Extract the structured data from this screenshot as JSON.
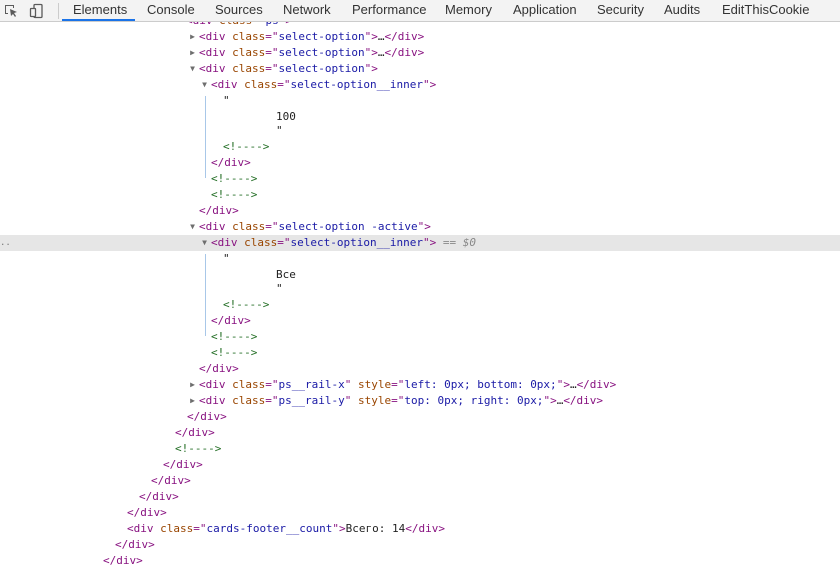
{
  "toolbar": {
    "tabs": [
      {
        "label": "Elements",
        "active": true
      },
      {
        "label": "Console"
      },
      {
        "label": "Sources"
      },
      {
        "label": "Network"
      },
      {
        "label": "Performance"
      },
      {
        "label": "Memory"
      },
      {
        "label": "Application"
      },
      {
        "label": "Security"
      },
      {
        "label": "Audits"
      },
      {
        "label": "EditThisCookie"
      }
    ],
    "icons": [
      "inspect-element-icon",
      "device-toolbar-icon"
    ]
  },
  "colors": {
    "tag": "#881280",
    "attribute": "#994500",
    "value": "#1a1aa6",
    "comment": "#236e25",
    "selected_row": "#e6e6e6",
    "active_tab": "#1a73e8"
  },
  "tree": {
    "selected_marker": "== $0",
    "ellipsis": "…",
    "lines": [
      {
        "t": "<div class=\"ps\">"
      },
      {
        "t": "<div class=\"select-option\">…</div>"
      },
      {
        "t": "<div class=\"select-option\">…</div>"
      },
      {
        "t": "<div class=\"select-option\">"
      },
      {
        "t": "<div class=\"select-option__inner\">"
      },
      {
        "t": "\""
      },
      {
        "t": ""
      },
      {
        "t": "100"
      },
      {
        "t": "\""
      },
      {
        "t": "<!---->"
      },
      {
        "t": "</div>"
      },
      {
        "t": "<!---->"
      },
      {
        "t": "<!---->"
      },
      {
        "t": "</div>"
      },
      {
        "t": "<div class=\"select-option -active\">"
      },
      {
        "t": "<div class=\"select-option__inner\">"
      },
      {
        "t": "\""
      },
      {
        "t": ""
      },
      {
        "t": "Все"
      },
      {
        "t": "\""
      },
      {
        "t": "<!---->"
      },
      {
        "t": "</div>"
      },
      {
        "t": "<!---->"
      },
      {
        "t": "<!---->"
      },
      {
        "t": "</div>"
      },
      {
        "t": "<div class=\"ps__rail-x\" style=\"left: 0px; bottom: 0px;\">…</div>"
      },
      {
        "t": "<div class=\"ps__rail-y\" style=\"top: 0px; right: 0px;\">…</div>"
      },
      {
        "t": "</div>"
      },
      {
        "t": "</div>"
      },
      {
        "t": "<!---->"
      },
      {
        "t": "</div>"
      },
      {
        "t": "</div>"
      },
      {
        "t": "</div>"
      },
      {
        "t": "</div>"
      },
      {
        "t": "<div class=\"cards-footer__count\">Всего: 14</div>"
      },
      {
        "t": "</div>"
      },
      {
        "t": "</div>"
      }
    ]
  }
}
